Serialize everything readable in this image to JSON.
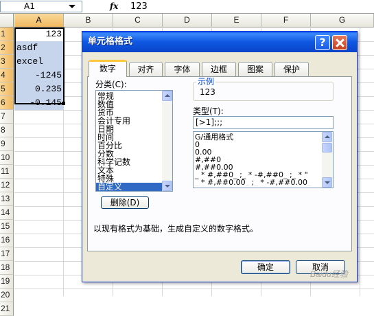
{
  "formula_bar": {
    "cell_ref": "A1",
    "fx_label": "fx",
    "value": "123"
  },
  "columns": [
    "A",
    "B",
    "C",
    "D",
    "E",
    "F",
    "G"
  ],
  "rows": [
    "1",
    "2",
    "3",
    "4",
    "5",
    "6",
    "7",
    "8",
    "9",
    "10",
    "11",
    "12",
    "13",
    "14",
    "15",
    "16",
    "17",
    "18",
    "19",
    "20",
    "21"
  ],
  "cells": [
    {
      "row": "1",
      "value": "123",
      "align": "right"
    },
    {
      "row": "2",
      "value": "asdf",
      "align": "left"
    },
    {
      "row": "3",
      "value": "excel",
      "align": "left"
    },
    {
      "row": "4",
      "value": "-1245",
      "align": "right"
    },
    {
      "row": "5",
      "value": "0.235",
      "align": "right"
    },
    {
      "row": "6",
      "value": "-0.145",
      "align": "right"
    }
  ],
  "dialog": {
    "title": "单元格格式",
    "help_label": "?",
    "tabs": [
      "数字",
      "对齐",
      "字体",
      "边框",
      "图案",
      "保护"
    ],
    "active_tab": "数字",
    "category_label": "分类(C):",
    "categories": [
      "常规",
      "数值",
      "货币",
      "会计专用",
      "日期",
      "时间",
      "百分比",
      "分数",
      "科学记数",
      "文本",
      "特殊",
      "自定义"
    ],
    "selected_category": "自定义",
    "sample_label": "示例",
    "sample_value": "123",
    "type_label": "类型(T):",
    "type_value": "[>1];;;",
    "type_list": [
      "G/通用格式",
      "0",
      "0.00",
      "#,##0",
      "#,##0.00",
      "_ * #,##0_ ;_ * -#,##0_ ;_ * \"",
      "_ * #,##0.00_ ;_ * -#,##0.00_"
    ],
    "delete_button": "删除(D)",
    "description": "以现有格式为基础，生成自定义的数字格式。",
    "ok_button": "确定",
    "cancel_button": "取消"
  },
  "watermark": "Baidu经验",
  "colors": {
    "selection_fill": "#c6d5ec",
    "title_bar": "#0a5bf0",
    "dialog_bg": "#ece9d8",
    "list_selected": "#316ac5"
  }
}
